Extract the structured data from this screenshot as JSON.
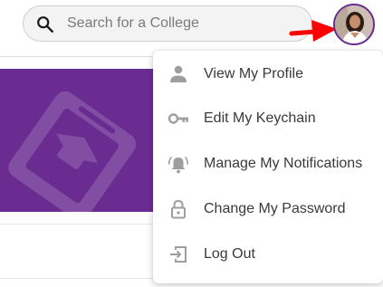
{
  "search": {
    "placeholder": "Search for a College",
    "value": ""
  },
  "user_menu": {
    "items": [
      {
        "label": "View My Profile",
        "icon": "person-icon"
      },
      {
        "label": "Edit My Keychain",
        "icon": "key-icon"
      },
      {
        "label": "Manage My Notifications",
        "icon": "bell-icon"
      },
      {
        "label": "Change My Password",
        "icon": "lock-icon"
      },
      {
        "label": "Log Out",
        "icon": "logout-icon"
      }
    ]
  },
  "colors": {
    "brand_purple": "#6a2c91",
    "annotation_arrow": "#ff0000",
    "menu_icon": "#9e9e9e",
    "menu_text": "#3a3a3a"
  }
}
